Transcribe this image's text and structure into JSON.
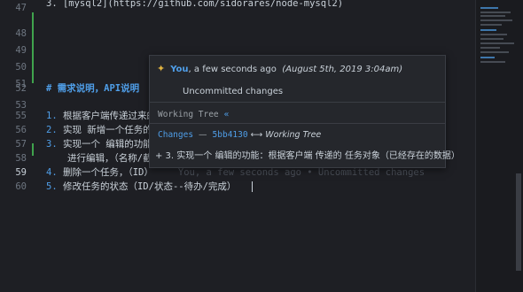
{
  "lines": [
    {
      "num": "47",
      "text": "3. [mysql2](https://github.com/sidorares/node-mysql2)"
    },
    {
      "num": "48",
      "text": ""
    },
    {
      "num": "49",
      "text": ""
    },
    {
      "num": "50",
      "text": ""
    },
    {
      "num": "51",
      "text": ""
    },
    {
      "num": "52",
      "text": "# 需求说明，API说明"
    },
    {
      "num": "53",
      "text": ""
    },
    {
      "num": "55",
      "text_marker": "1.",
      "text": "根据客户端传递过来的"
    },
    {
      "num": "56",
      "text_marker": "2.",
      "text": "实现 新增一个任务的功"
    },
    {
      "num": "57",
      "text_marker": "3.",
      "text": "实现一个 编辑的功能："
    },
    {
      "num": "58",
      "text": "进行编辑，（名称/截"
    },
    {
      "num": "59",
      "text_marker": "4.",
      "text": "删除一个任务，（ID）"
    },
    {
      "num": "60",
      "text_marker": "5.",
      "text": "修改任务的状态（ID/状态--待办/完成）"
    }
  ],
  "blame": "You, a few seconds ago • Uncommitted changes",
  "hover": {
    "author": "You",
    "relative_time": ", a few seconds ago",
    "date": "(August 5th, 2019 3:04am)",
    "message": "Uncommitted changes",
    "working_tree_label": "Working Tree",
    "working_tree_arrow": "«",
    "changes_label": "Changes",
    "changes_sep": "—",
    "sha": "5bb4130",
    "compare_arrow": "⟷",
    "compare_target": "Working Tree",
    "diff_line": "+ 3. 实现一个 编辑的功能：根据客户端 传递的 任务对象（已经存在的数据）"
  },
  "colors": {
    "accent": "#4f9ee8",
    "modified_bar": "#3fa34d",
    "background": "#1e1f24"
  }
}
